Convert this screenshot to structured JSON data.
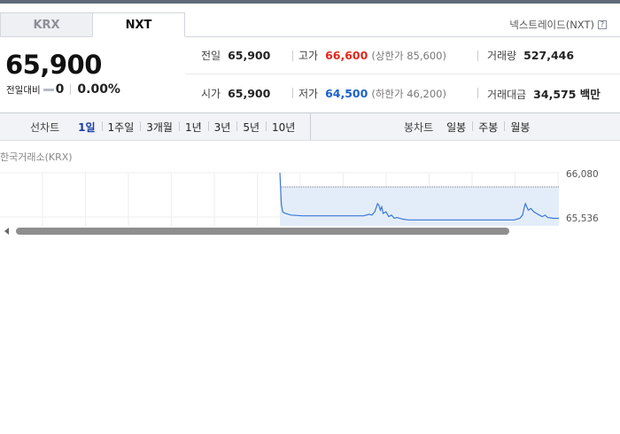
{
  "tabs": [
    {
      "label": "KRX",
      "active": false
    },
    {
      "label": "NXT",
      "active": true
    }
  ],
  "nxt_link": {
    "label": "넥스트레이드(NXT)",
    "icon": "help-icon"
  },
  "quote": {
    "price": "65,900",
    "change_label": "전일대비",
    "change_value": "0",
    "change_pct": "0.00%"
  },
  "stats": {
    "prev_close": {
      "label": "전일",
      "value": "65,900"
    },
    "high": {
      "label": "고가",
      "value": "66,600",
      "sub": "(상한가 85,600)"
    },
    "volume": {
      "label": "거래량",
      "value": "527,446"
    },
    "open": {
      "label": "시가",
      "value": "65,900"
    },
    "low": {
      "label": "저가",
      "value": "64,500",
      "sub": "(하한가 46,200)"
    },
    "amount": {
      "label": "거래대금",
      "value": "34,575 백만"
    }
  },
  "toolbar": {
    "line_title": "선차트",
    "periods": [
      "1일",
      "1주일",
      "3개월",
      "1년",
      "3년",
      "5년",
      "10년"
    ],
    "selected_period": "1일",
    "candle_title": "봉차트",
    "candle_periods": [
      "일봉",
      "주봉",
      "월봉"
    ]
  },
  "exchange_label": "한국거래소(KRX)",
  "colors": {
    "up": "#e0281e",
    "down": "#1a62c9",
    "line": "#3a78d8",
    "fill": "#e3edf9"
  },
  "chart_data": {
    "type": "line",
    "y_ticks": [
      "66,080",
      "65,536"
    ],
    "ylim": [
      65250,
      66150
    ],
    "points": [
      [
        0.0,
        66080
      ],
      [
        0.005,
        65700
      ],
      [
        0.01,
        65600
      ],
      [
        0.02,
        65580
      ],
      [
        0.04,
        65560
      ],
      [
        0.08,
        65550
      ],
      [
        0.12,
        65550
      ],
      [
        0.16,
        65550
      ],
      [
        0.2,
        65550
      ],
      [
        0.26,
        65550
      ],
      [
        0.3,
        65550
      ],
      [
        0.32,
        65570
      ],
      [
        0.33,
        65560
      ],
      [
        0.34,
        65600
      ],
      [
        0.345,
        65650
      ],
      [
        0.35,
        65700
      ],
      [
        0.355,
        65680
      ],
      [
        0.36,
        65620
      ],
      [
        0.365,
        65660
      ],
      [
        0.37,
        65580
      ],
      [
        0.38,
        65600
      ],
      [
        0.39,
        65540
      ],
      [
        0.4,
        65560
      ],
      [
        0.41,
        65520
      ],
      [
        0.42,
        65530
      ],
      [
        0.44,
        65510
      ],
      [
        0.46,
        65500
      ],
      [
        0.48,
        65500
      ],
      [
        0.52,
        65500
      ],
      [
        0.56,
        65500
      ],
      [
        0.6,
        65500
      ],
      [
        0.64,
        65500
      ],
      [
        0.68,
        65500
      ],
      [
        0.72,
        65500
      ],
      [
        0.76,
        65500
      ],
      [
        0.8,
        65500
      ],
      [
        0.84,
        65500
      ],
      [
        0.86,
        65520
      ],
      [
        0.87,
        65560
      ],
      [
        0.875,
        65640
      ],
      [
        0.88,
        65700
      ],
      [
        0.885,
        65660
      ],
      [
        0.89,
        65620
      ],
      [
        0.9,
        65640
      ],
      [
        0.91,
        65600
      ],
      [
        0.92,
        65580
      ],
      [
        0.93,
        65560
      ],
      [
        0.94,
        65540
      ],
      [
        0.95,
        65560
      ],
      [
        0.96,
        65530
      ],
      [
        0.98,
        65520
      ],
      [
        1.0,
        65520
      ]
    ]
  }
}
